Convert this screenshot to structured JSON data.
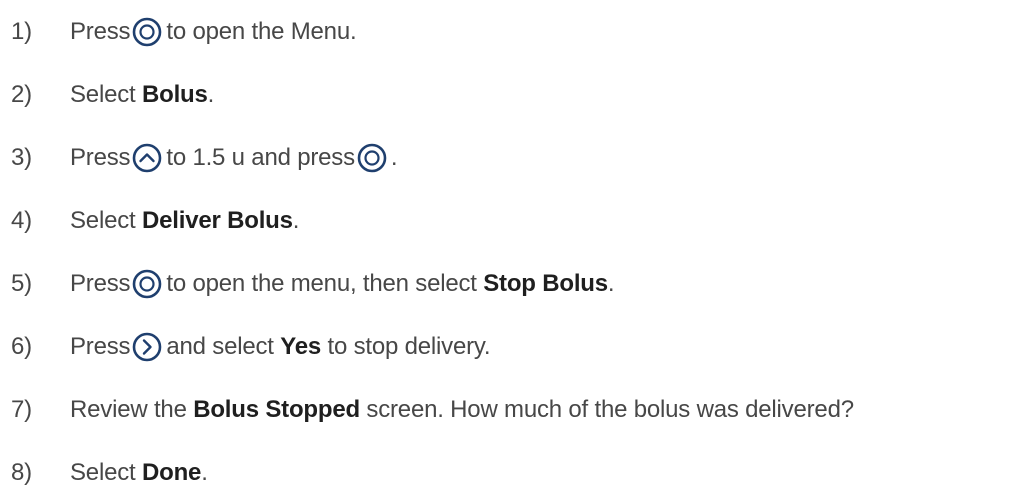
{
  "colors": {
    "text": "#474747",
    "bold_text": "#1f1f1f",
    "icon_ring": "#1f3f6e"
  },
  "steps": [
    {
      "num": "1)",
      "a": "Press",
      "b": "to open the Menu."
    },
    {
      "num": "2)",
      "a": "Select",
      "bold": "Bolus",
      "b": "."
    },
    {
      "num": "3)",
      "a": "Press",
      "b": "to 1.5 u and press",
      "c": "."
    },
    {
      "num": "4)",
      "a": "Select",
      "bold": "Deliver Bolus",
      "b": "."
    },
    {
      "num": "5)",
      "a": "Press",
      "b": "to open the menu, then select",
      "bold": "Stop Bolus",
      "c": "."
    },
    {
      "num": "6)",
      "a": "Press",
      "b": "and select",
      "bold": "Yes",
      "c": "to stop delivery."
    },
    {
      "num": "7)",
      "a": "Review the",
      "bold": "Bolus Stopped",
      "b": "screen. How much of the bolus was delivered?"
    },
    {
      "num": "8)",
      "a": "Select",
      "bold": "Done",
      "b": "."
    }
  ],
  "icons": {
    "select_button": "o-button-icon",
    "up_button": "up-arrow-button-icon",
    "right_button": "right-arrow-button-icon"
  }
}
